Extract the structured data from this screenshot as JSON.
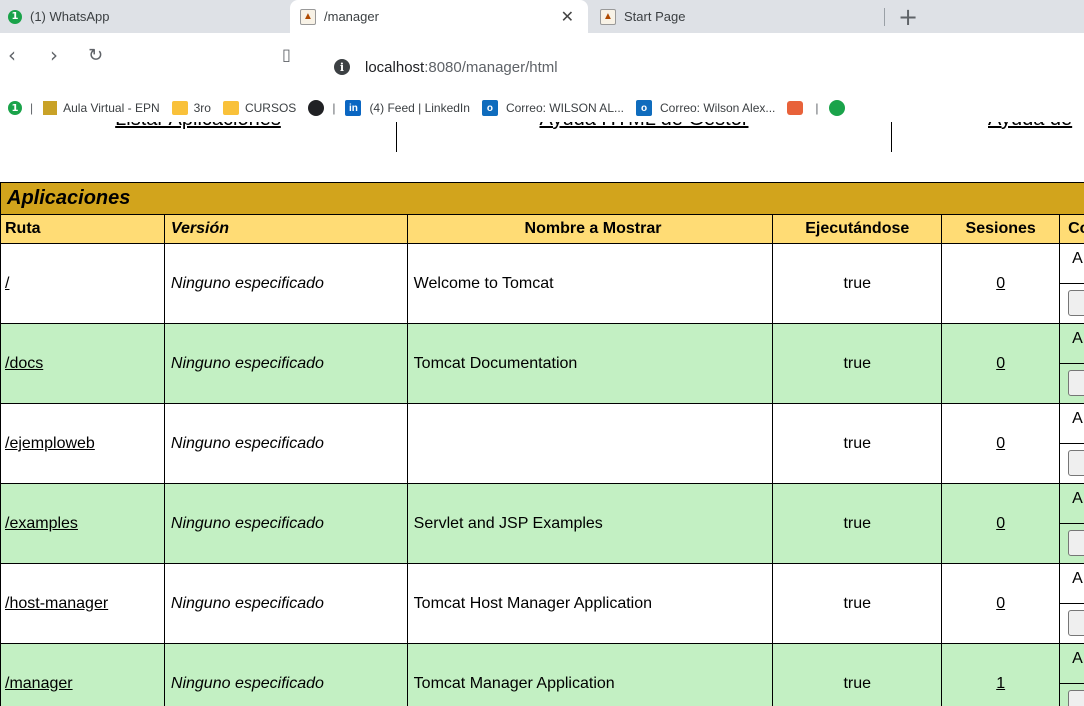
{
  "tabs": [
    {
      "label": "(1) WhatsApp",
      "badge": "1"
    },
    {
      "label": "/manager"
    },
    {
      "label": "Start Page"
    }
  ],
  "toolbar": {
    "url_host": "localhost",
    "url_path": ":8080/manager/html"
  },
  "bookmarks": [
    {
      "label": "Aula Virtual - EPN"
    },
    {
      "label": "3ro"
    },
    {
      "label": "CURSOS"
    },
    {
      "label": "(4) Feed | LinkedIn"
    },
    {
      "label": "Correo: WILSON AL..."
    },
    {
      "label": "Correo: Wilson Alex..."
    }
  ],
  "whatsapp_badge": "1",
  "topnav": {
    "list_apps": "Listar Aplicaciones",
    "help_html": "Ayuda HTML de Gestor",
    "help_other": "Ayuda de"
  },
  "apps": {
    "title": "Aplicaciones",
    "headers": {
      "path": "Ruta",
      "version": "Versión",
      "display_name": "Nombre a Mostrar",
      "running": "Ejecutándose",
      "sessions": "Sesiones",
      "commands": "Co"
    },
    "rows": [
      {
        "path": "/",
        "version": "Ninguno especificado",
        "display_name": "Welcome to Tomcat",
        "running": "true",
        "sessions": "0",
        "cmd": "A"
      },
      {
        "path": "/docs",
        "version": "Ninguno especificado",
        "display_name": "Tomcat Documentation",
        "running": "true",
        "sessions": "0",
        "cmd": "A"
      },
      {
        "path": "/ejemploweb",
        "version": "Ninguno especificado",
        "display_name": "",
        "running": "true",
        "sessions": "0",
        "cmd": "A"
      },
      {
        "path": "/examples",
        "version": "Ninguno especificado",
        "display_name": "Servlet and JSP Examples",
        "running": "true",
        "sessions": "0",
        "cmd": "A"
      },
      {
        "path": "/host-manager",
        "version": "Ninguno especificado",
        "display_name": "Tomcat Host Manager Application",
        "running": "true",
        "sessions": "0",
        "cmd": "A"
      },
      {
        "path": "/manager",
        "version": "Ninguno especificado",
        "display_name": "Tomcat Manager Application",
        "running": "true",
        "sessions": "1",
        "cmd": "A"
      }
    ]
  }
}
